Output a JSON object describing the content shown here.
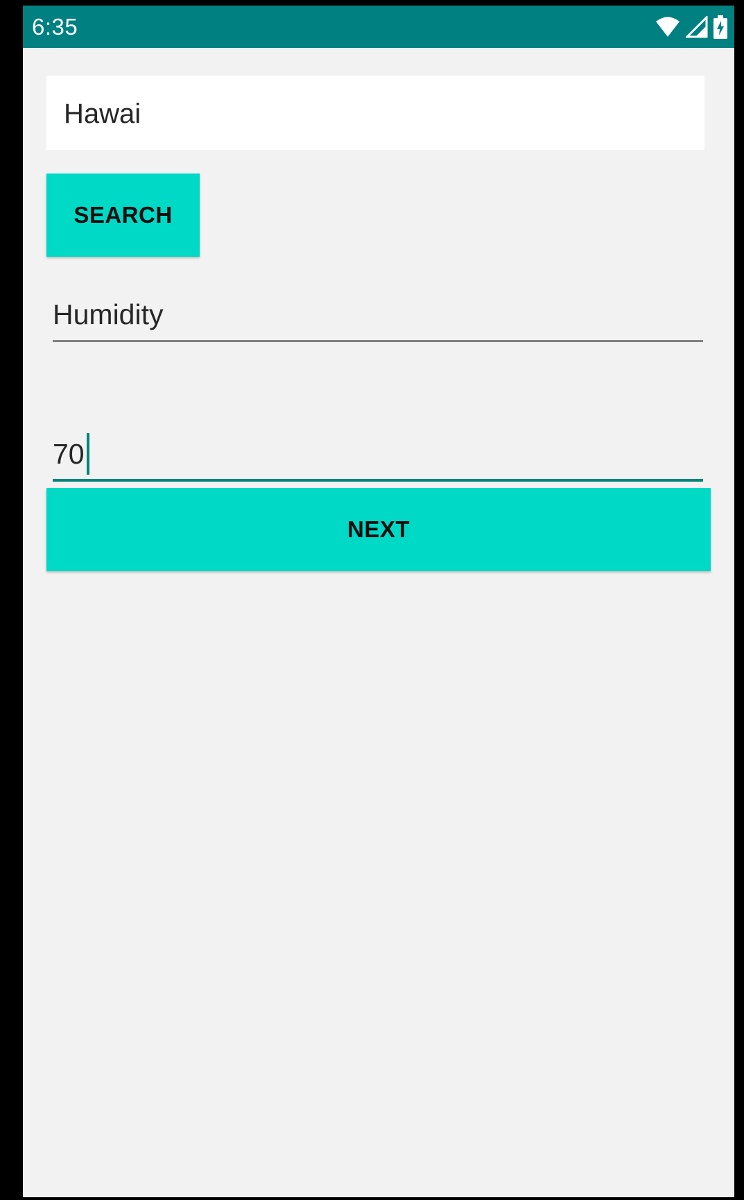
{
  "status_bar": {
    "time": "6:35",
    "icons": [
      "wifi-icon",
      "cellular-signal-icon",
      "battery-charging-icon"
    ]
  },
  "search": {
    "value": "Hawai",
    "button_label": "SEARCH"
  },
  "humidity_field": {
    "value": "Humidity"
  },
  "value_field": {
    "value": "70"
  },
  "next_button": {
    "label": "NEXT"
  },
  "colors": {
    "status_bar": "#008080",
    "accent": "#00d9c5",
    "focused_underline": "#008577",
    "background": "#f2f2f2"
  }
}
